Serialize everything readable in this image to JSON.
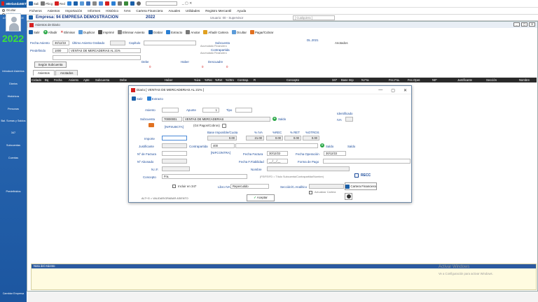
{
  "app": {
    "brand": "eBelandaNET",
    "toolbar": [
      {
        "label": "Sali",
        "icon": "exit-icon",
        "color": "#1a5fa8"
      },
      {
        "label": "Pbcg",
        "icon": "pbcg-icon",
        "color": "#555"
      },
      {
        "label": "Red",
        "icon": "red-icon",
        "color": "#d62020"
      }
    ],
    "window_controls": "_ ▢ ✕"
  },
  "radios": {
    "ocultar": "Ocultar",
    "visible": "Visible"
  },
  "menu": [
    "Ficheros",
    "Asientos",
    "Importación",
    "Informes",
    "Histórico",
    "IVAs",
    "Cartera Financiera",
    "Anuales",
    "Utilidades",
    "Registro Mercantil",
    "Ayuda"
  ],
  "empresa": {
    "label": "Empresa: 94  EMPRESA DEMOSTRACION",
    "year": "2022",
    "user": "Usuario: 00 - Supervisor",
    "placeholder": "[ Cualquiera ]"
  },
  "sidebar": {
    "caption": "ASIGNACION DE USUARIO",
    "year": "2022",
    "items": [
      "Introducir Asientos",
      "Diarios",
      "Históricos",
      "Personas",
      "Bal. Sumas y Saldos",
      "347",
      "Subcuentas",
      "Cuentas",
      "Predefinidos"
    ],
    "cambiar": "Cambiar Empresa"
  },
  "mainwin": {
    "title": "Asientos de Diario",
    "toolbar": [
      "Salir",
      "Añadir",
      "Eliminar",
      "Duplicar",
      "Imprimir",
      "Eliminar Asiento",
      "Grabar",
      "Extracto",
      "Anotar",
      "Añadir Cartera",
      "Ocultar",
      "Pagar/Cobrar"
    ],
    "fecha_asiento_label": "Fecha Asiento",
    "fecha_asiento": "30/12/22",
    "ultimo_asiento_label": "Último Asiento Grabado",
    "capitulo_label": "Capítulo",
    "predefinido_label": "Predefinido",
    "predefinido_code": "1000",
    "predefinido_value": "VENTAS DE MERCADERIAS AL 21%",
    "subcuenta_label": "Subcuenta",
    "contrapartida_label": "Contrapartida",
    "acum_label": "Acumulado Financiero",
    "anotados": "Anotados",
    "dl_label": "DL.2021",
    "debe_label": "Debe",
    "haber_label": "Haber",
    "descuadre_label": "Descuadre",
    "debe": "0",
    "haber": "0",
    "descuadre": "0",
    "segun_btn": "Según Subcuenta",
    "tabs": [
      "Asientos",
      "Anotados"
    ],
    "columns": [
      "Ciclado",
      "Bq",
      "Fecha",
      "Asiento",
      "Apte",
      "Subcuenta",
      "Debe",
      "Haber",
      "%iva",
      "%Rec",
      "%Ret",
      "%Otro",
      "Contrap.",
      "R",
      "Concepto",
      "347",
      "Base Imp",
      "N.Fra",
      "Fec.Fra.",
      "Fec.Oper.",
      "NIF",
      "Justificante",
      "Sección",
      "Nombre"
    ],
    "notes_label": "Nota del Asiento",
    "activate_title": "Activar Windows",
    "activate_sub": "Ve a Configuración para activar Windows."
  },
  "dialog": {
    "title": "Diario [  VENTAS DE MERCADERIAS AL 21% ]",
    "controls": [
      "—",
      "▢",
      "✕"
    ],
    "tools": [
      "Salir",
      "Extracto"
    ],
    "asiento_label": "Asiento",
    "apunte_label": "Apunte",
    "apunte": "1",
    "tipo_label": "Tipo",
    "subcuenta_label": "Subcuenta",
    "subcuenta_code": "70000001",
    "subcuenta_name": "VENTAS DE MERCADERIAS",
    "saldo_label": "Saldo",
    "identificado_label": "Identificado",
    "iva_label": "IVA",
    "nifsubcta": "[NIFSUBCTA]",
    "pagos": "(G4 Pagos/Cobros)",
    "importe_label": "Importe",
    "base_label": "Base Imponible/Cuota",
    "porc_iva_label": "% IVA",
    "porc_rec_label": "%REC",
    "porc_ret_label": "% RET",
    "porc_otros_label": "%OTROS",
    "base": "0.00",
    "iva": "21.00",
    "rec": "0.00",
    "ret": "0.00",
    "otros": "0.00",
    "justificante_label": "Justificante",
    "contrapartida_label": "Contrapartida",
    "contrapartida": "400",
    "saldo2_label": "Saldo",
    "saldo3_label": "Saldo",
    "nfactura_label": "Nº de Factura",
    "nifcontra": "[NIFCONTRA]",
    "fecha_factura_label": "Fecha Factura",
    "fecha_factura": "30/12/22",
    "fecha_operacion_label": "Fecha Operación",
    "fecha_operacion": "30/12/22",
    "nabonado_label": "Nº Abonado",
    "fecha_fiabilidad_label": "Fecha F.Fiabilidad",
    "fecha_fiab": "__/__/__",
    "forma_pago_label": "Forma de Pago",
    "nif_label": "N.I.F.",
    "nombre_label": "Nombre",
    "concepto_label": "Concepto",
    "concepto": "Fra.",
    "concepto_hint": "(FE/FE/FD = Título Subcuenta/Contrapartida/Nombre)",
    "recc": "RECC",
    "incluir_347": "Incluir en 347",
    "libro_iva_label": "Libro IVA",
    "libro_iva": "Repercutido",
    "seccion_label": "Sección/C.Analítico",
    "actualizar_cartera": "Actualizar Cartera",
    "cartera_btn": "Cartera Financiera",
    "aceptar": "Aceptar",
    "validar": "ALT+G = VALIDAR/GRABAR ASIENTO"
  }
}
